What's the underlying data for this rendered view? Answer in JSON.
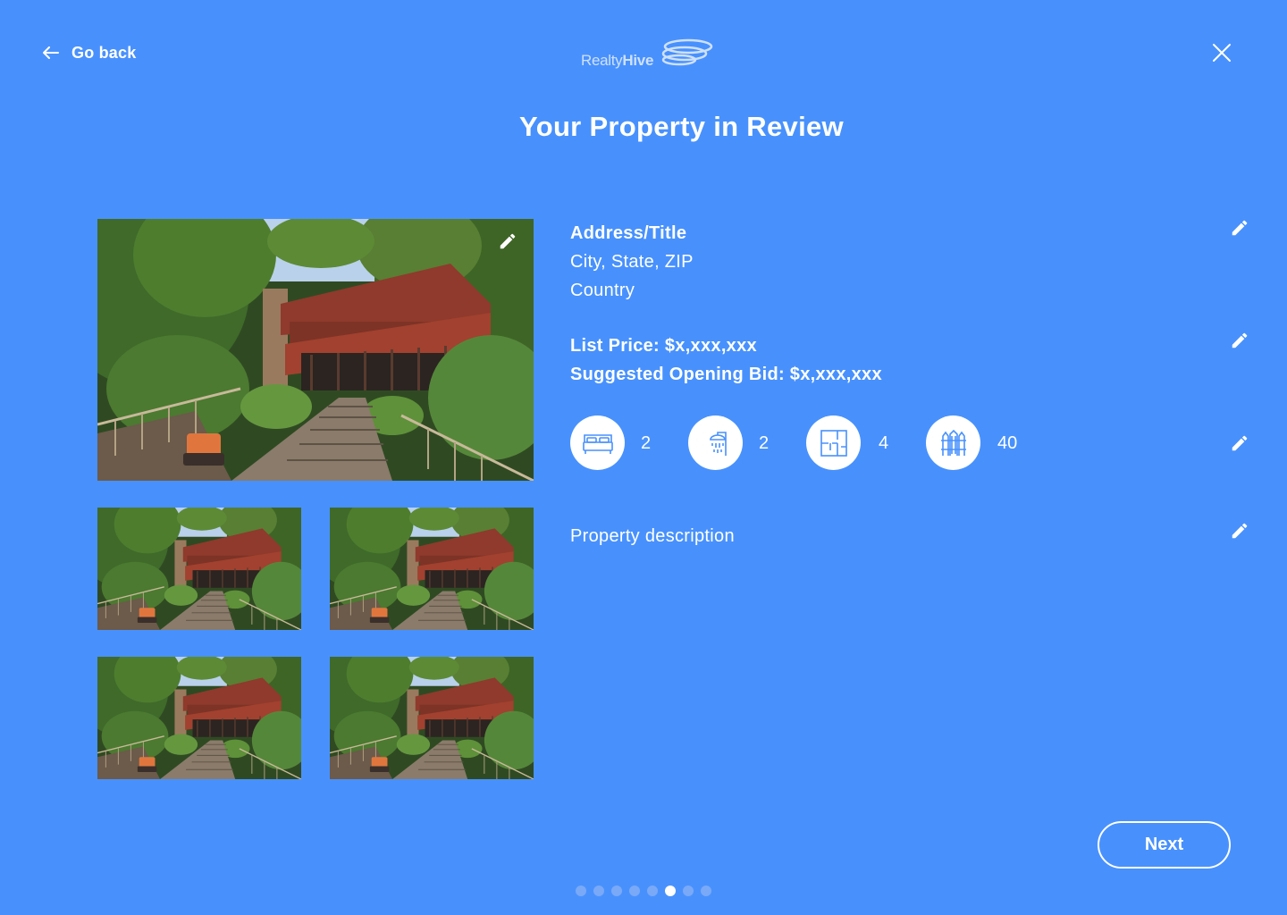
{
  "header": {
    "back_label": "Go back",
    "logo_text_light": "Realty",
    "logo_text_bold": "Hive",
    "title": "Your Property in Review"
  },
  "property": {
    "address_title": "Address/Title",
    "city_state_zip": "City, State, ZIP",
    "country": "Country",
    "list_price": "List Price: $x,xxx,xxx",
    "suggested_bid": "Suggested Opening Bid: $x,xxx,xxx",
    "description": "Property description"
  },
  "features": [
    {
      "icon": "bed-icon",
      "count": "2"
    },
    {
      "icon": "shower-icon",
      "count": "2"
    },
    {
      "icon": "floorplan-icon",
      "count": "4"
    },
    {
      "icon": "fence-icon",
      "count": "40"
    }
  ],
  "footer": {
    "next_label": "Next",
    "pagination": {
      "total": 8,
      "active": 6
    }
  },
  "colors": {
    "background": "#4891fd",
    "accent": "#4891fd",
    "text": "#ffffff",
    "dot_inactive": "#7aa9f7"
  }
}
